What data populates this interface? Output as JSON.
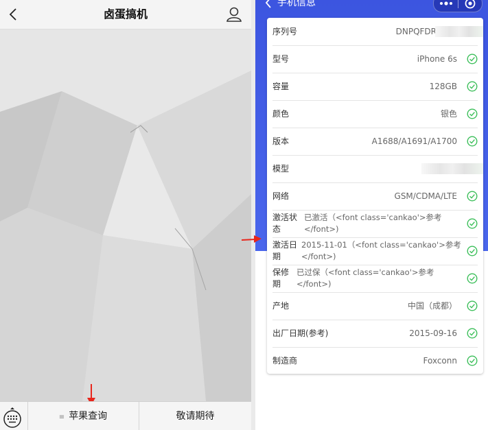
{
  "left": {
    "title": "卤蛋搞机",
    "bottom_menu": {
      "apple_query": "苹果查询",
      "coming_soon": "敬请期待"
    }
  },
  "right": {
    "nav_title": "手机信息",
    "rows": [
      {
        "label": "序列号",
        "value": "DNPQFDR"
      },
      {
        "label": "型号",
        "value": "iPhone 6s"
      },
      {
        "label": "容量",
        "value": "128GB"
      },
      {
        "label": "颜色",
        "value": "银色"
      },
      {
        "label": "版本",
        "value": "A1688/A1691/A1700"
      },
      {
        "label": "模型",
        "value": ""
      },
      {
        "label": "网络",
        "value": "GSM/CDMA/LTE"
      },
      {
        "label_l1": "激活状",
        "label_l2": "态",
        "value_l1": "已激活（<font class='cankao'>参考",
        "value_l2": "</font>)"
      },
      {
        "label_l1": "激活日",
        "label_l2": "期",
        "value_l1": "2015-11-01（<font class='cankao'>参考",
        "value_l2": "</font>)"
      },
      {
        "label_l1": "保修",
        "label_l2": "期",
        "value_l1": "已过保（<font class='cankao'>参考",
        "value_l2": "</font>)"
      },
      {
        "label": "产地",
        "value": "中国（成都）"
      },
      {
        "label": "出厂日期(参考)",
        "value": "2015-09-16"
      },
      {
        "label": "制造商",
        "value": "Foxconn"
      }
    ]
  },
  "colors": {
    "header_blue": "#4a66ec",
    "check_green": "#3cbf5a",
    "arrow_red": "#e8261c"
  }
}
